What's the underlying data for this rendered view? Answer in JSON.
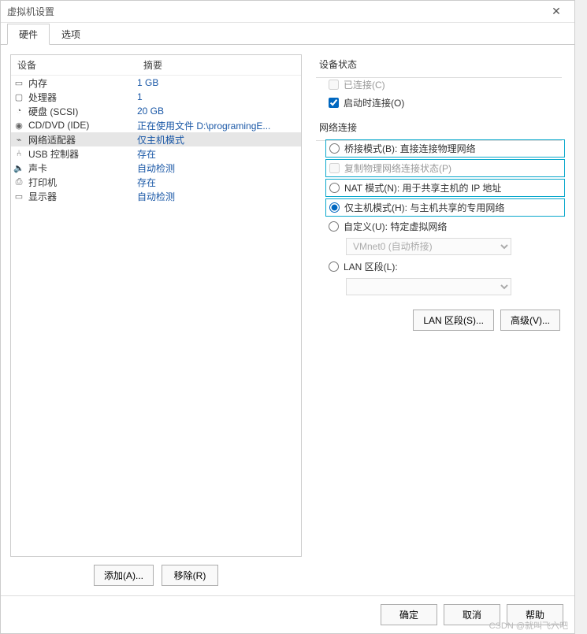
{
  "title": "虚拟机设置",
  "tabs": {
    "hardware": "硬件",
    "options": "选项"
  },
  "listHeader": {
    "device": "设备",
    "summary": "摘要"
  },
  "devices": [
    {
      "icon": "▭",
      "name": "内存",
      "summary": "1 GB"
    },
    {
      "icon": "▢",
      "name": "处理器",
      "summary": "1"
    },
    {
      "icon": "◔",
      "name": "硬盘 (SCSI)",
      "summary": "20 GB"
    },
    {
      "icon": "◉",
      "name": "CD/DVD (IDE)",
      "summary": "正在使用文件 D:\\programingE..."
    },
    {
      "icon": "⌁",
      "name": "网络适配器",
      "summary": "仅主机模式",
      "selected": true
    },
    {
      "icon": "⑃",
      "name": "USB 控制器",
      "summary": "存在"
    },
    {
      "icon": "🔈",
      "name": "声卡",
      "summary": "自动检测"
    },
    {
      "icon": "⎙",
      "name": "打印机",
      "summary": "存在"
    },
    {
      "icon": "▭",
      "name": "显示器",
      "summary": "自动检测"
    }
  ],
  "leftButtons": {
    "add": "添加(A)...",
    "remove": "移除(R)"
  },
  "statusGroup": {
    "title": "设备状态",
    "connected": "已连接(C)",
    "connectAtPower": "启动时连接(O)"
  },
  "netGroup": {
    "title": "网络连接",
    "bridged": "桥接模式(B): 直接连接物理网络",
    "replicate": "复制物理网络连接状态(P)",
    "nat": "NAT 模式(N): 用于共享主机的 IP 地址",
    "hostOnly": "仅主机模式(H): 与主机共享的专用网络",
    "custom": "自定义(U): 特定虚拟网络",
    "vmnet": "VMnet0 (自动桥接)",
    "lanSegment": "LAN 区段(L):",
    "lanSelect": ""
  },
  "rightButtons": {
    "lan": "LAN 区段(S)...",
    "adv": "高级(V)..."
  },
  "dialogButtons": {
    "ok": "确定",
    "cancel": "取消",
    "help": "帮助"
  },
  "watermark": "CSDN @就叫飞六吧"
}
